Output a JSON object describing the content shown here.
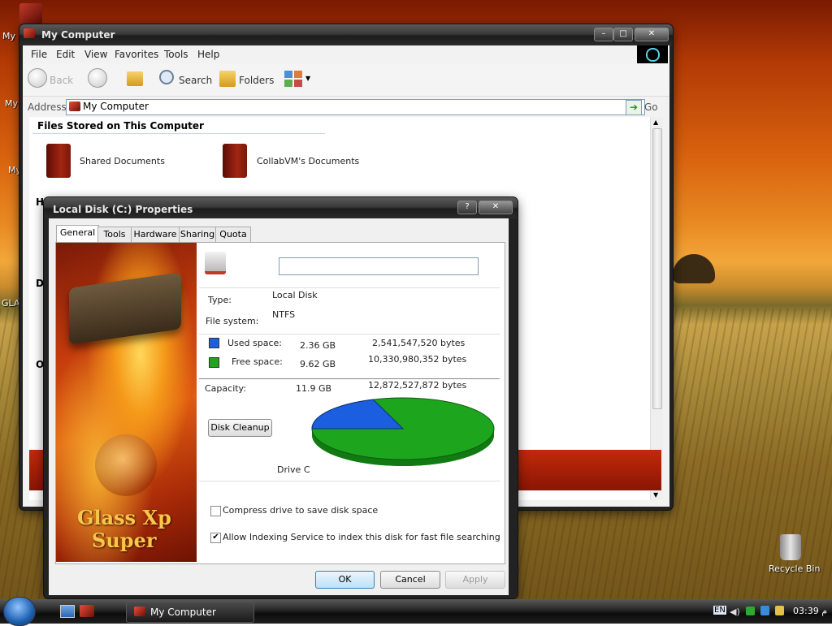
{
  "desktop": {
    "labels": [
      "My",
      "My",
      "My",
      "GLA",
      "Recycle Bin"
    ]
  },
  "explorer": {
    "title": "My Computer",
    "menu": [
      "File",
      "Edit",
      "View",
      "Favorites",
      "Tools",
      "Help"
    ],
    "toolbar": {
      "back": "Back",
      "search": "Search",
      "folders": "Folders"
    },
    "address": {
      "label": "Address",
      "value": "My Computer",
      "go": "Go"
    },
    "section": "Files Stored on This Computer",
    "items": [
      "Shared Documents",
      "CollabVM's Documents"
    ],
    "partial_headers": [
      "Ha",
      "De",
      "Ot"
    ]
  },
  "dialog": {
    "title": "Local Disk (C:) Properties",
    "help": "?",
    "close": "✕",
    "tabs": [
      "General",
      "Tools",
      "Hardware",
      "Sharing",
      "Quota"
    ],
    "name_value": "",
    "type_label": "Type:",
    "type_value": "Local Disk",
    "fs_label": "File system:",
    "fs_value": "NTFS",
    "used_label": "Used space:",
    "used_gb": "2.36 GB",
    "used_bytes": "2,541,547,520 bytes",
    "free_label": "Free space:",
    "free_gb": "9.62 GB",
    "free_bytes": "10,330,980,352 bytes",
    "capacity_label": "Capacity:",
    "capacity_gb": "11.9 GB",
    "capacity_bytes": "12,872,527,872 bytes",
    "cleanup": "Disk Cleanup",
    "drive_label": "Drive C",
    "compress": "Compress drive to save disk space",
    "indexing": "Allow Indexing Service to index this disk for fast file searching",
    "compress_checked": false,
    "indexing_checked": true,
    "ok": "OK",
    "cancel": "Cancel",
    "apply": "Apply",
    "art_text_1": "Glass Xp",
    "art_text_2": "Super",
    "used_color": "#1c5ee0",
    "free_color": "#1ea51e",
    "used_fraction": 0.197
  },
  "taskbar": {
    "task": "My Computer",
    "lang": "EN",
    "time": "03:39 م"
  }
}
